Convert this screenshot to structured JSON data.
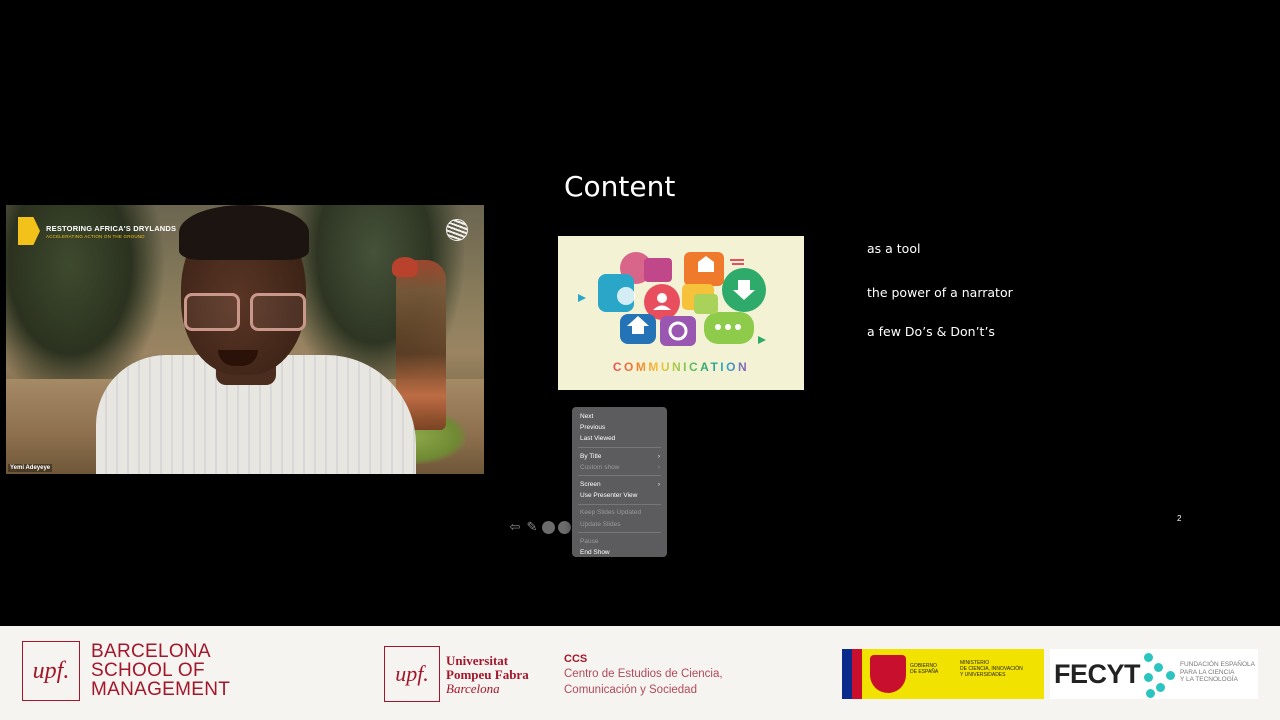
{
  "video": {
    "brand_title": "RESTORING AFRICA'S DRYLANDS",
    "brand_subtitle": "ACCELERATING ACTION ON THE GROUND",
    "speaker_name": "Yemi Adeyeye"
  },
  "slide": {
    "title": "Content",
    "image_caption": "COMMUNICATION",
    "bullets": [
      "as a tool",
      "the power of a narrator",
      "a few Do’s & Don’t’s"
    ],
    "page_number": "2"
  },
  "context_menu": {
    "groups": [
      [
        {
          "label": "Next",
          "enabled": true
        },
        {
          "label": "Previous",
          "enabled": true
        },
        {
          "label": "Last Viewed",
          "enabled": true
        }
      ],
      [
        {
          "label": "By Title",
          "enabled": true,
          "submenu": true
        },
        {
          "label": "Custom show",
          "enabled": false,
          "submenu": true
        }
      ],
      [
        {
          "label": "Screen",
          "enabled": true,
          "submenu": true
        },
        {
          "label": "Use Presenter View",
          "enabled": true
        }
      ],
      [
        {
          "label": "Keep Slides Updated",
          "enabled": false
        },
        {
          "label": "Update Slides",
          "enabled": false
        }
      ],
      [
        {
          "label": "Pause",
          "enabled": false
        },
        {
          "label": "End Show",
          "enabled": true
        }
      ]
    ]
  },
  "footer": {
    "upf_mark": "upf.",
    "bsm_lines": [
      "BARCELONA",
      "SCHOOL OF",
      "MANAGEMENT"
    ],
    "university_lines": [
      "Universitat",
      "Pompeu Fabra"
    ],
    "university_city": "Barcelona",
    "ccs_abbr": "CCS",
    "ccs_lines": [
      "Centro de Estudios de Ciencia,",
      "Comunicación y Sociedad"
    ],
    "gov_lines": [
      "GOBIERNO",
      "DE ESPAÑA"
    ],
    "ministry_lines": [
      "MINISTERIO",
      "DE CIENCIA, INNOVACIÓN",
      "Y UNIVERSIDADES"
    ],
    "fecyt": "FECYT",
    "fecyt_lines": [
      "FUNDACIÓN ESPAÑOLA",
      "PARA LA CIENCIA",
      "Y LA TECNOLOGÍA"
    ]
  },
  "colors": {
    "upf_red": "#a3172b",
    "menu_bg": "#5c5c5e",
    "brand_yellow": "#f2c21b",
    "fecyt_teal": "#2cc4c0"
  }
}
